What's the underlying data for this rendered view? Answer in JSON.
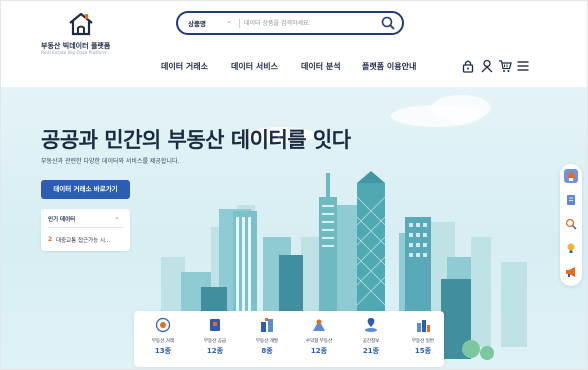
{
  "header": {
    "logo": {
      "title": "부동산 빅데이터 플랫폼",
      "subtitle": "Real Estate Big Data Platform"
    },
    "search": {
      "category": "상품명",
      "placeholder": "데이터 상품을 검색하세요."
    },
    "nav": [
      {
        "label": "데이터 거래소"
      },
      {
        "label": "데이터 서비스"
      },
      {
        "label": "데이터 분석"
      },
      {
        "label": "플랫폼 이용안내"
      }
    ],
    "utilities": [
      "lock-icon",
      "user-icon",
      "cart-icon",
      "menu-icon"
    ]
  },
  "hero": {
    "headline": "공공과 민간의 부동산 데이터를 잇다",
    "subline": "부동산과 관련한 다양한 데이터와 서비스를 제공합니다.",
    "cta_label": "데이터 거래소 바로가기",
    "popular": {
      "title": "인기 데이터",
      "rank": "2",
      "item": "대중교통 접근가능 시..."
    }
  },
  "categories": [
    {
      "label": "부동산 거래",
      "count": "13종",
      "icon": "transaction-icon"
    },
    {
      "label": "부동산 공급",
      "count": "12종",
      "icon": "supply-icon"
    },
    {
      "label": "부동산 개발",
      "count": "8종",
      "icon": "development-icon"
    },
    {
      "label": "수익형 부동산",
      "count": "12종",
      "icon": "income-property-icon"
    },
    {
      "label": "공간정보",
      "count": "21종",
      "icon": "spatial-info-icon"
    },
    {
      "label": "부동산 일반",
      "count": "15종",
      "icon": "general-icon"
    }
  ],
  "side_tools": [
    "home-icon",
    "document-icon",
    "search-analysis-icon",
    "idea-icon",
    "megaphone-icon"
  ],
  "colors": {
    "primary": "#2c5db1",
    "navy": "#1e2c46",
    "accent_orange": "#e66b1c",
    "sky": "#dff2f6"
  }
}
